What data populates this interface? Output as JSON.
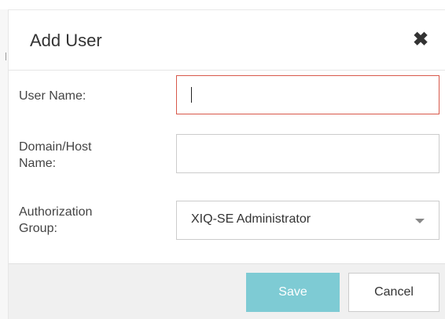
{
  "dialog": {
    "title": "Add User",
    "close_icon": "close-icon",
    "close_glyph": "✖"
  },
  "form": {
    "user_name": {
      "label": "User Name:",
      "value": ""
    },
    "domain_host": {
      "label_line1": "Domain/Host",
      "label_line2": "Name:",
      "value": ""
    },
    "authorization_group": {
      "label_line1": "Authorization",
      "label_line2": "Group:",
      "selected": "XIQ-SE Administrator"
    }
  },
  "footer": {
    "save_label": "Save",
    "cancel_label": "Cancel"
  },
  "colors": {
    "save_button": "#7ecbd4",
    "focused_border": "#d8584a",
    "footer_bg": "#f0f0f0"
  }
}
